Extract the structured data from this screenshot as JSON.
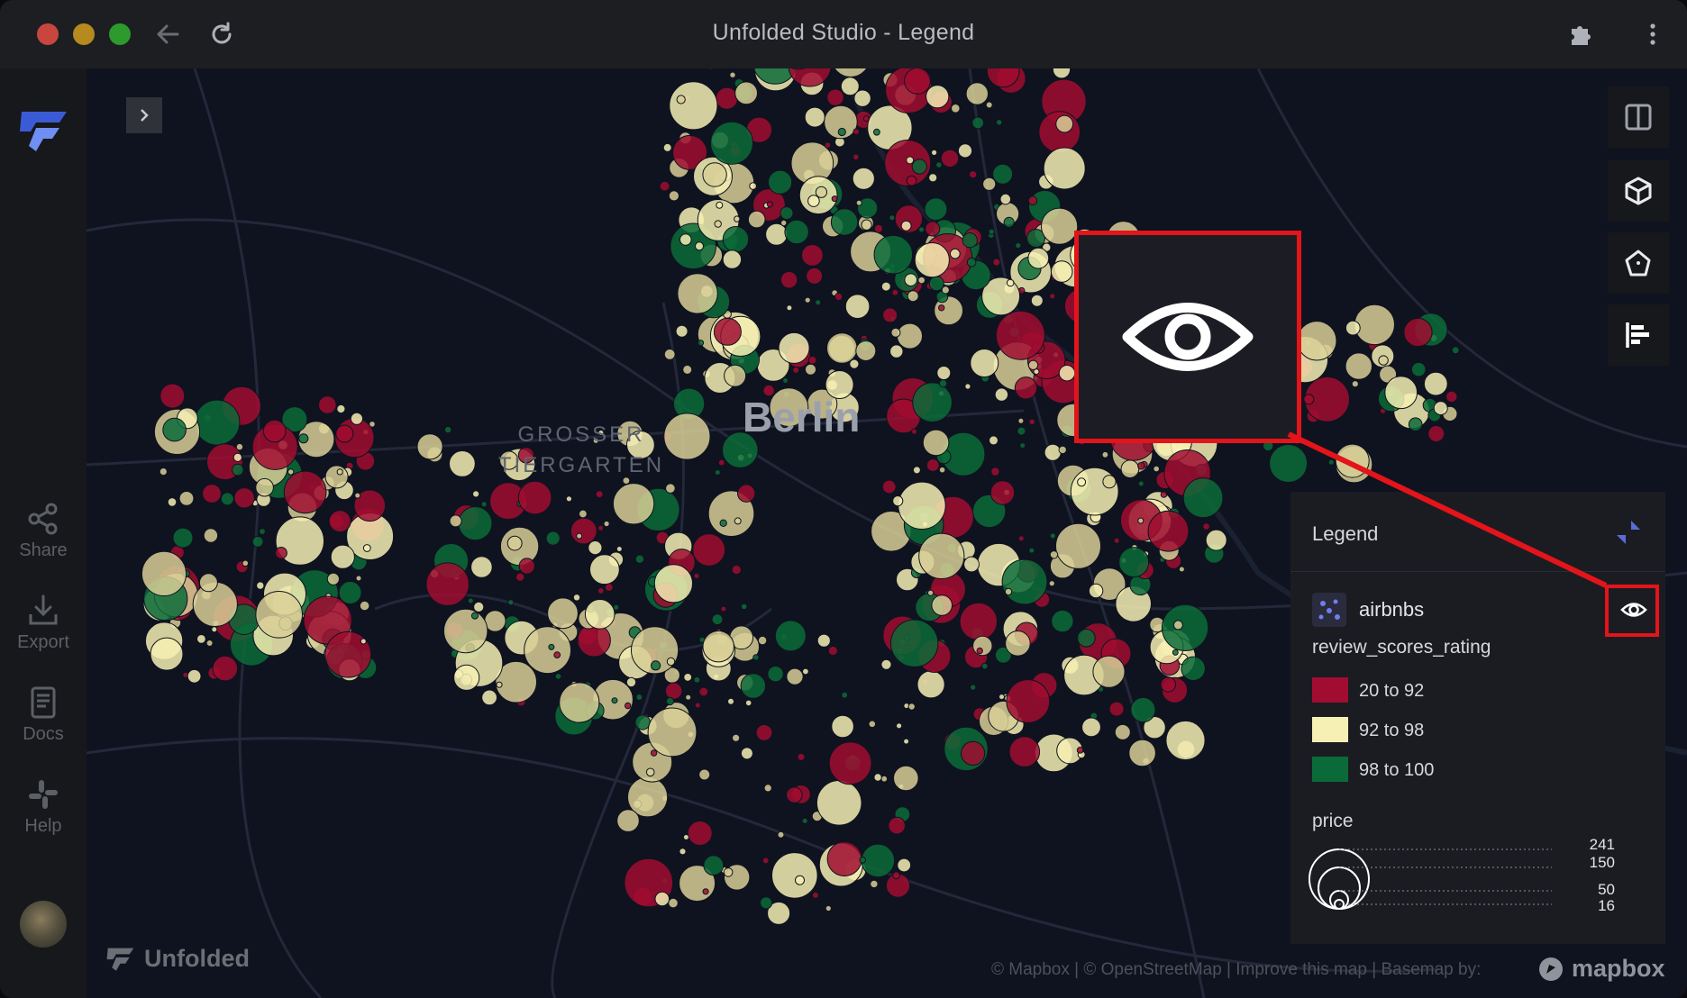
{
  "window": {
    "title": "Unfolded Studio - Legend"
  },
  "sidebar": {
    "items": [
      {
        "label": "Share",
        "icon": "share-icon"
      },
      {
        "label": "Export",
        "icon": "export-icon"
      },
      {
        "label": "Docs",
        "icon": "docs-icon"
      },
      {
        "label": "Help",
        "icon": "slack-icon"
      }
    ]
  },
  "map": {
    "city_label": "Berlin",
    "park_label_line1": "GROSSER",
    "park_label_line2": "TIERGARTEN",
    "brand": "Unfolded",
    "attribution": "© Mapbox | © OpenStreetMap | Improve this map | Basemap by:",
    "mapbox_label": "mapbox",
    "tools": [
      "split-map-icon",
      "3d-cube-icon",
      "draw-polygon-icon",
      "legend-icon"
    ]
  },
  "legend": {
    "title": "Legend",
    "layer_name": "airbnbs",
    "color_field": "review_scores_rating",
    "color_ranges": [
      {
        "label": "20 to 92",
        "color": "#a00d30"
      },
      {
        "label": "92 to 98",
        "color": "#f6f0b4"
      },
      {
        "label": "98 to 100",
        "color": "#0a6b38"
      }
    ],
    "size_field": "price",
    "size_values": [
      "241",
      "150",
      "50",
      "16"
    ]
  },
  "colors": {
    "highlight": "#e3141a",
    "red": "#a00d30",
    "yellow": "#f6f0b4",
    "green": "#0a6b38"
  }
}
